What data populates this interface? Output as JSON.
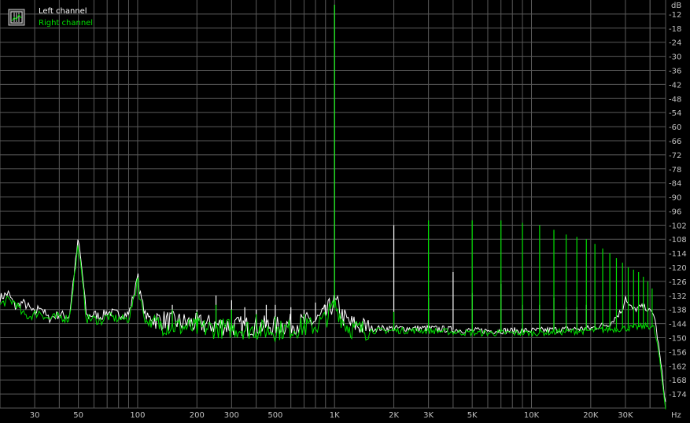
{
  "chart_data": {
    "type": "line",
    "title": "",
    "xlabel": "",
    "ylabel": "",
    "x_unit": "Hz",
    "y_unit": "dB",
    "x_scale": "log",
    "xlim": [
      20,
      48000
    ],
    "ylim": [
      -180,
      -6
    ],
    "grid": true,
    "legend_position": "top-left",
    "x_tick_values": [
      30,
      50,
      100,
      200,
      300,
      500,
      1000,
      2000,
      3000,
      5000,
      10000,
      20000,
      30000
    ],
    "x_tick_labels": [
      "30",
      "50",
      "100",
      "200",
      "300",
      "500",
      "1K",
      "2K",
      "3K",
      "5K",
      "10K",
      "20K",
      "30K"
    ],
    "y_tick_values": [
      -12,
      -18,
      -24,
      -30,
      -36,
      -42,
      -48,
      -54,
      -60,
      -66,
      -72,
      -78,
      -84,
      -90,
      -96,
      -102,
      -108,
      -114,
      -120,
      -126,
      -132,
      -138,
      -144,
      -150,
      -156,
      -162,
      -168,
      -174
    ],
    "y_tick_labels": [
      "-12",
      "-18",
      "-24",
      "-30",
      "-36",
      "-42",
      "-48",
      "-54",
      "-60",
      "-66",
      "-72",
      "-78",
      "-84",
      "-90",
      "-96",
      "-102",
      "-108",
      "-114",
      "-120",
      "-126",
      "-132",
      "-138",
      "-144",
      "-150",
      "-156",
      "-162",
      "-168",
      "-174"
    ],
    "colors": {
      "Left channel": "#ffffff",
      "Right channel": "#00e000",
      "grid": "#5a5a5a",
      "background": "#000000"
    },
    "series": [
      {
        "name": "Left channel",
        "noise_floor_db": -145,
        "points": [
          [
            20,
            -133
          ],
          [
            22,
            -131
          ],
          [
            24,
            -137
          ],
          [
            26,
            -135
          ],
          [
            28,
            -137
          ],
          [
            30,
            -140
          ],
          [
            32,
            -136
          ],
          [
            35,
            -142
          ],
          [
            40,
            -140
          ],
          [
            45,
            -141
          ],
          [
            48,
            -120
          ],
          [
            50,
            -108
          ],
          [
            52,
            -120
          ],
          [
            55,
            -141
          ],
          [
            60,
            -140
          ],
          [
            65,
            -141
          ],
          [
            70,
            -139
          ],
          [
            80,
            -140
          ],
          [
            90,
            -140
          ],
          [
            98,
            -128
          ],
          [
            100,
            -120
          ],
          [
            102,
            -130
          ],
          [
            110,
            -141
          ],
          [
            120,
            -142
          ],
          [
            150,
            -143
          ],
          [
            200,
            -144
          ],
          [
            300,
            -145
          ],
          [
            500,
            -145
          ],
          [
            800,
            -143
          ],
          [
            900,
            -140
          ],
          [
            950,
            -137
          ],
          [
            1000,
            -135
          ],
          [
            1050,
            -137
          ],
          [
            1100,
            -141
          ],
          [
            1200,
            -144
          ],
          [
            1500,
            -146
          ],
          [
            2000,
            -146
          ],
          [
            3000,
            -146
          ],
          [
            5000,
            -147
          ],
          [
            10000,
            -147
          ],
          [
            20000,
            -146
          ],
          [
            25000,
            -144
          ],
          [
            27000,
            -141
          ],
          [
            29000,
            -138
          ],
          [
            30000,
            -132
          ],
          [
            31000,
            -136
          ],
          [
            33000,
            -138
          ],
          [
            36000,
            -137
          ],
          [
            38000,
            -137
          ],
          [
            40000,
            -139
          ],
          [
            42000,
            -140
          ],
          [
            44000,
            -152
          ],
          [
            46000,
            -165
          ],
          [
            48000,
            -178
          ]
        ],
        "spikes": [
          [
            60,
            -139
          ],
          [
            150,
            -136
          ],
          [
            200,
            -138
          ],
          [
            250,
            -132
          ],
          [
            300,
            -134
          ],
          [
            350,
            -137
          ],
          [
            400,
            -138
          ],
          [
            450,
            -136
          ],
          [
            500,
            -136
          ],
          [
            600,
            -137
          ],
          [
            700,
            -138
          ],
          [
            800,
            -135
          ],
          [
            900,
            -136
          ],
          [
            1000,
            -8
          ],
          [
            2000,
            -102
          ],
          [
            3000,
            -133
          ],
          [
            4000,
            -122
          ],
          [
            5000,
            -131
          ],
          [
            7000,
            -127
          ],
          [
            9000,
            -136
          ],
          [
            11000,
            -136
          ],
          [
            13000,
            -133
          ],
          [
            15000,
            -137
          ],
          [
            17000,
            -137
          ],
          [
            19000,
            -136
          ],
          [
            21000,
            -138
          ]
        ]
      },
      {
        "name": "Right channel",
        "noise_floor_db": -146,
        "points": [
          [
            20,
            -136
          ],
          [
            22,
            -134
          ],
          [
            24,
            -135
          ],
          [
            26,
            -140
          ],
          [
            28,
            -141
          ],
          [
            30,
            -140
          ],
          [
            32,
            -139
          ],
          [
            35,
            -142
          ],
          [
            40,
            -141
          ],
          [
            45,
            -142
          ],
          [
            48,
            -122
          ],
          [
            50,
            -110
          ],
          [
            52,
            -124
          ],
          [
            55,
            -142
          ],
          [
            60,
            -142
          ],
          [
            65,
            -143
          ],
          [
            70,
            -141
          ],
          [
            80,
            -142
          ],
          [
            90,
            -142
          ],
          [
            98,
            -130
          ],
          [
            100,
            -122
          ],
          [
            102,
            -132
          ],
          [
            110,
            -143
          ],
          [
            120,
            -144
          ],
          [
            150,
            -145
          ],
          [
            200,
            -146
          ],
          [
            300,
            -146
          ],
          [
            500,
            -147
          ],
          [
            800,
            -145
          ],
          [
            900,
            -142
          ],
          [
            950,
            -139
          ],
          [
            1000,
            -136
          ],
          [
            1050,
            -139
          ],
          [
            1100,
            -143
          ],
          [
            1200,
            -146
          ],
          [
            1500,
            -147
          ],
          [
            2000,
            -147
          ],
          [
            3000,
            -147
          ],
          [
            5000,
            -148
          ],
          [
            10000,
            -148
          ],
          [
            20000,
            -147
          ],
          [
            30000,
            -146
          ],
          [
            40000,
            -145
          ],
          [
            42000,
            -146
          ],
          [
            44000,
            -155
          ],
          [
            46000,
            -168
          ],
          [
            48000,
            -180
          ]
        ],
        "spikes": [
          [
            150,
            -138
          ],
          [
            200,
            -139
          ],
          [
            250,
            -136
          ],
          [
            300,
            -138
          ],
          [
            400,
            -140
          ],
          [
            500,
            -141
          ],
          [
            700,
            -140
          ],
          [
            1000,
            -8
          ],
          [
            2000,
            -139
          ],
          [
            3000,
            -100
          ],
          [
            5000,
            -100
          ],
          [
            7000,
            -100
          ],
          [
            9000,
            -101
          ],
          [
            11000,
            -102
          ],
          [
            13000,
            -104
          ],
          [
            15000,
            -106
          ],
          [
            17000,
            -107
          ],
          [
            19000,
            -108
          ],
          [
            21000,
            -110
          ],
          [
            23000,
            -112
          ],
          [
            25000,
            -114
          ],
          [
            27000,
            -116
          ],
          [
            29000,
            -118
          ],
          [
            31000,
            -120
          ],
          [
            33000,
            -121
          ],
          [
            35000,
            -122
          ],
          [
            37000,
            -124
          ],
          [
            39000,
            -126
          ],
          [
            41000,
            -129
          ]
        ]
      }
    ]
  }
}
